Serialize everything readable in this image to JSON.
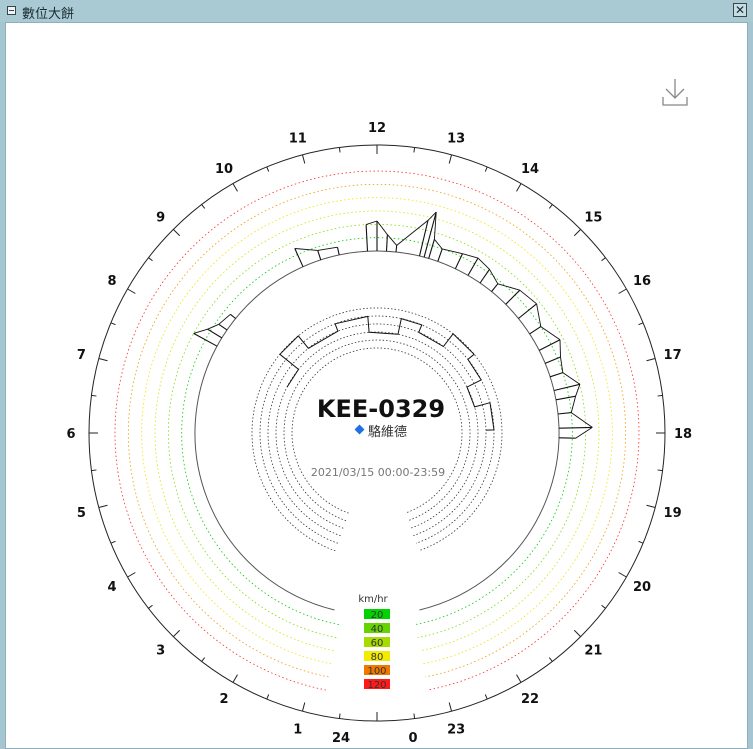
{
  "window": {
    "title": "數位大餅",
    "close_glyph": "✕"
  },
  "colors": {
    "ring_20": "#00cc00",
    "ring_40": "#7fdc00",
    "ring_60": "#cfe600",
    "ring_80": "#f0e400",
    "ring_100": "#f09a00",
    "ring_120": "#ff2a2a",
    "accent": "#1f6fe5"
  },
  "chart": {
    "title": "KEE-0329",
    "driver_icon": "diamond-icon",
    "driver": "駱維德",
    "date_range": "2021/03/15 00:00-23:59",
    "download_icon": "download-icon",
    "legend": {
      "unit": "km/hr",
      "items": [
        {
          "label": "20",
          "color": "#00d400"
        },
        {
          "label": "40",
          "color": "#66d400"
        },
        {
          "label": "60",
          "color": "#a8dc00"
        },
        {
          "label": "80",
          "color": "#f2ec00"
        },
        {
          "label": "100",
          "color": "#f07800"
        },
        {
          "label": "120",
          "color": "#ff1a1a"
        }
      ]
    }
  },
  "chart_data": {
    "type": "radial",
    "title": "KEE-0329",
    "hours": [
      "0",
      "1",
      "2",
      "3",
      "4",
      "5",
      "6",
      "7",
      "8",
      "9",
      "10",
      "11",
      "12",
      "13",
      "14",
      "15",
      "16",
      "17",
      "18",
      "19",
      "20",
      "21",
      "22",
      "23",
      "24"
    ],
    "speed_rings_kmh": [
      20,
      40,
      60,
      80,
      100,
      120
    ],
    "speed_max_kmh": 120,
    "speed_series": [
      {
        "t": 7.9,
        "v": 40
      },
      {
        "t": 8.1,
        "v": 25
      },
      {
        "t": 8.3,
        "v": 15
      },
      {
        "t": 8.6,
        "v": 10
      },
      {
        "t": 10.4,
        "v": 30
      },
      {
        "t": 10.8,
        "v": 15
      },
      {
        "t": 11.2,
        "v": 12
      },
      {
        "t": 11.8,
        "v": 40
      },
      {
        "t": 12.0,
        "v": 45
      },
      {
        "t": 12.2,
        "v": 25
      },
      {
        "t": 12.4,
        "v": 10
      },
      {
        "t": 12.9,
        "v": 55
      },
      {
        "t": 13.0,
        "v": 70
      },
      {
        "t": 13.1,
        "v": 30
      },
      {
        "t": 13.3,
        "v": 20
      },
      {
        "t": 13.7,
        "v": 25
      },
      {
        "t": 14.0,
        "v": 30
      },
      {
        "t": 14.3,
        "v": 25
      },
      {
        "t": 14.6,
        "v": 15
      },
      {
        "t": 15.0,
        "v": 30
      },
      {
        "t": 15.4,
        "v": 35
      },
      {
        "t": 15.8,
        "v": 20
      },
      {
        "t": 16.2,
        "v": 35
      },
      {
        "t": 16.5,
        "v": 25
      },
      {
        "t": 16.8,
        "v": 20
      },
      {
        "t": 17.1,
        "v": 40
      },
      {
        "t": 17.3,
        "v": 30
      },
      {
        "t": 17.6,
        "v": 20
      },
      {
        "t": 17.9,
        "v": 50
      },
      {
        "t": 18.1,
        "v": 25
      }
    ],
    "inner_track": [
      {
        "t": 7.8,
        "lane": 2
      },
      {
        "t": 8.6,
        "lane": 5
      },
      {
        "t": 9.4,
        "lane": 3
      },
      {
        "t": 10.6,
        "lane": 4
      },
      {
        "t": 11.7,
        "lane": 2
      },
      {
        "t": 12.8,
        "lane": 4
      },
      {
        "t": 13.5,
        "lane": 3
      },
      {
        "t": 14.5,
        "lane": 5
      },
      {
        "t": 15.4,
        "lane": 4
      },
      {
        "t": 16.2,
        "lane": 2
      },
      {
        "t": 17.0,
        "lane": 4
      },
      {
        "t": 17.9,
        "lane": 3
      }
    ]
  }
}
